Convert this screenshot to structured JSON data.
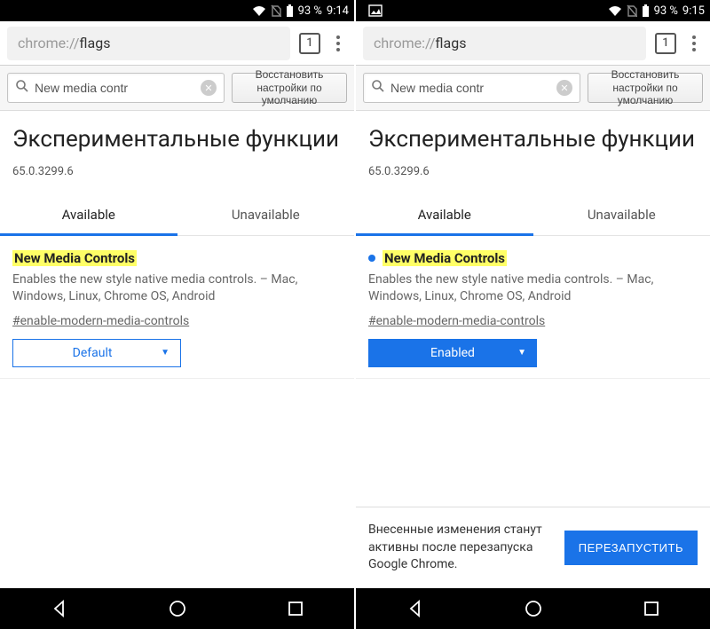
{
  "left": {
    "status": {
      "battery_pct": "93 %",
      "time": "9:14"
    },
    "url": {
      "prefix": "chrome://",
      "path": "flags"
    },
    "tab_count": "1",
    "toolbar": {
      "search_value": "New media contr",
      "reset_label": "Восстановить настройки по умолчанию"
    },
    "page": {
      "title": "Экспериментальные функции",
      "version": "65.0.3299.6",
      "tabs": {
        "available": "Available",
        "unavailable": "Unavailable"
      }
    },
    "flag": {
      "title": "New Media Controls",
      "desc": "Enables the new style native media controls. – Mac, Windows, Linux, Chrome OS, Android",
      "link": "#enable-modern-media-controls",
      "select_value": "Default"
    }
  },
  "right": {
    "status": {
      "battery_pct": "93 %",
      "time": "9:15"
    },
    "url": {
      "prefix": "chrome://",
      "path": "flags"
    },
    "tab_count": "1",
    "toolbar": {
      "search_value": "New media contr",
      "reset_label": "Восстановить настройки по умолчанию"
    },
    "page": {
      "title": "Экспериментальные функции",
      "version": "65.0.3299.6",
      "tabs": {
        "available": "Available",
        "unavailable": "Unavailable"
      }
    },
    "flag": {
      "title": "New Media Controls",
      "desc": "Enables the new style native media controls. – Mac, Windows, Linux, Chrome OS, Android",
      "link": "#enable-modern-media-controls",
      "select_value": "Enabled"
    },
    "restart": {
      "message": "Внесенные изменения станут активны после перезапуска Google Chrome.",
      "button": "ПЕРЕЗАПУСТИТЬ"
    }
  }
}
